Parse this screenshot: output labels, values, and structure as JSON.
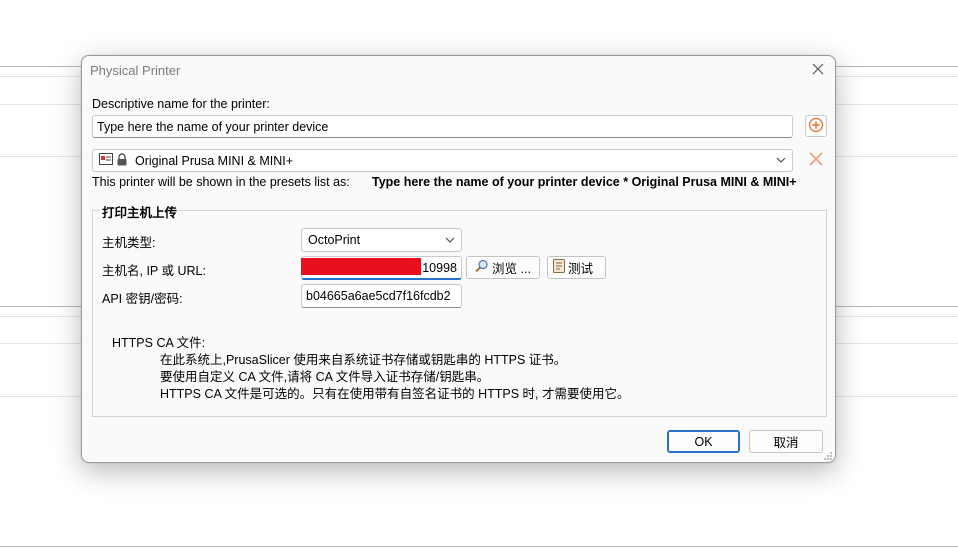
{
  "dialog": {
    "title": "Physical Printer",
    "descriptive_label": "Descriptive name for the printer:",
    "name_placeholder": "Type here the name of your printer device",
    "preset_selected": "Original Prusa MINI & MINI+",
    "shown_as_label": "This printer will be shown in the presets list as:",
    "shown_as_value": "Type here the name of your printer device * Original Prusa MINI & MINI+",
    "group_title": "打印主机上传",
    "host_type_label": "主机类型:",
    "host_type_value": "OctoPrint",
    "host_label": "主机名, IP  或 URL:",
    "host_value_tail": "10998",
    "browse_label": "浏览 ...",
    "test_label": "测试",
    "api_label": "API 密钥/密码:",
    "api_value": "b04665a6ae5cd7f16fcdb2",
    "https_title": "HTTPS CA 文件:",
    "https_line1": "在此系统上,PrusaSlicer 使用来自系统证书存储或钥匙串的 HTTPS 证书。",
    "https_line2": "要使用自定义 CA 文件,请将 CA 文件导入证书存储/钥匙串。",
    "https_line3": "HTTPS CA 文件是可选的。只有在使用带有自签名证书的 HTTPS 时, 才需要使用它。",
    "ok_label": "OK",
    "cancel_label": "取消"
  },
  "icons": {
    "add": "plus-circle-icon",
    "delete": "x-icon",
    "printer": "printer-icon",
    "lock": "lock-icon",
    "search": "magnifier-icon",
    "test": "test-icon",
    "close": "close-icon"
  },
  "colors": {
    "accent": "#2a6fc9",
    "orange": "#ed6b21",
    "redaction": "#e8101e"
  }
}
